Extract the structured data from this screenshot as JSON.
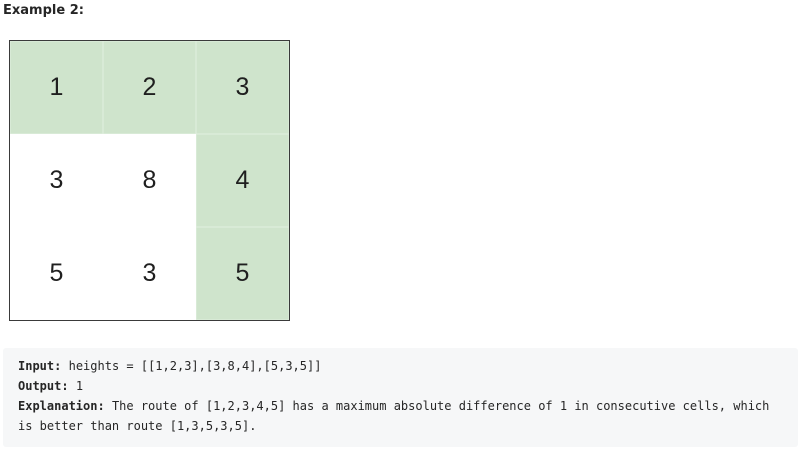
{
  "heading": "Example 2:",
  "grid": {
    "rows": [
      [
        {
          "value": "1",
          "on_path": true
        },
        {
          "value": "2",
          "on_path": true
        },
        {
          "value": "3",
          "on_path": true
        }
      ],
      [
        {
          "value": "3",
          "on_path": false
        },
        {
          "value": "8",
          "on_path": false
        },
        {
          "value": "4",
          "on_path": true
        }
      ],
      [
        {
          "value": "5",
          "on_path": false
        },
        {
          "value": "3",
          "on_path": false
        },
        {
          "value": "5",
          "on_path": true
        }
      ]
    ],
    "path_color": "#cfe4cc",
    "border_color": "#3a3a3a"
  },
  "example": {
    "input_label": "Input:",
    "input_value": "heights = [[1,2,3],[3,8,4],[5,3,5]]",
    "output_label": "Output:",
    "output_value": "1",
    "explanation_label": "Explanation:",
    "explanation_value": "The route of [1,2,3,4,5] has a maximum absolute difference of 1 in consecutive cells, which is better than route [1,3,5,3,5]."
  }
}
